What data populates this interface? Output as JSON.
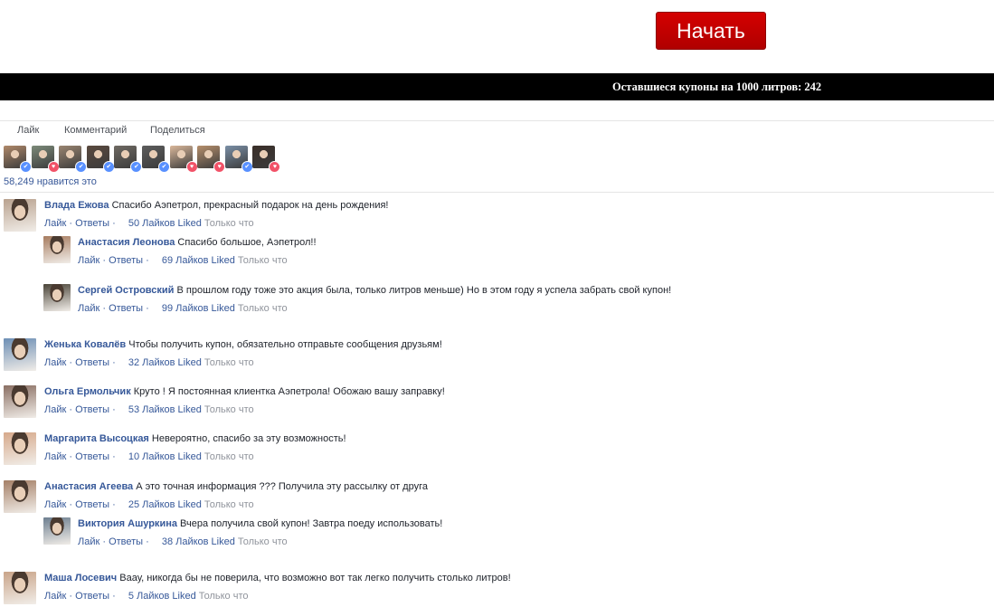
{
  "start_button": {
    "label": "Начать"
  },
  "coupon_bar": {
    "text": "Оставшиеся купоны на 1000 литров: 242"
  },
  "actions": {
    "like": "Лайк",
    "comment": "Комментарий",
    "share": "Поделиться"
  },
  "reactions": {
    "likes_count_text": "58,249 нравится это",
    "reactors": [
      {
        "reaction": "like",
        "color": "#b0896a"
      },
      {
        "reaction": "love",
        "color": "#7d8b7a"
      },
      {
        "reaction": "like",
        "color": "#9a8571"
      },
      {
        "reaction": "like",
        "color": "#5b4a3f"
      },
      {
        "reaction": "like",
        "color": "#6f6a63"
      },
      {
        "reaction": "like",
        "color": "#5d5d5d"
      },
      {
        "reaction": "love",
        "color": "#d9b79a"
      },
      {
        "reaction": "love",
        "color": "#b68f6c"
      },
      {
        "reaction": "like",
        "color": "#7a8fa6"
      },
      {
        "reaction": "love",
        "color": "#3a2e28"
      }
    ]
  },
  "labels": {
    "like": "Лайк",
    "replies": "Ответы",
    "just_now": "Только что",
    "separator": "·"
  },
  "comments": [
    {
      "author": "Влада Ежова",
      "text": "Спасибо Аэпетрол, прекрасный подарок на день рождения!",
      "likes": "50 Лайков Liked",
      "avatar_color": "#b9a28f"
    },
    {
      "author": "Анастасия Леонова",
      "text": "Спасибо большое, Аэпетрол!!",
      "likes": "69 Лайков Liked",
      "avatar_color": "#a77c5f"
    },
    {
      "author": "Сергей Островский",
      "text": "В прошлом году тоже это акция была, только литров меньше) Но в этом году я успела забрать свой купон!",
      "likes": "99 Лайков Liked",
      "avatar_color": "#4a4438"
    },
    {
      "author": "Женька Ковалёв",
      "text": "Чтобы получить купон, обязательно отправьте сообщения друзьям!",
      "likes": "32 Лайков Liked",
      "avatar_color": "#6d8fb5"
    },
    {
      "author": "Ольга Ермольчик",
      "text": "Круто ! Я постоянная клиентка Аэпетрола! Обожаю вашу заправку!",
      "likes": "53 Лайков Liked",
      "avatar_color": "#8a6f63"
    },
    {
      "author": "Маргарита Высоцкая",
      "text": "Невероятно, спасибо за эту возможность!",
      "likes": "10 Лайков Liked",
      "avatar_color": "#d6a98b"
    },
    {
      "author": "Анастасия Агеева",
      "text": "А это точная информация ??? Получила эту рассылку от друга",
      "likes": "25 Лайков Liked",
      "avatar_color": "#a58067"
    },
    {
      "author": "Виктория Ашуркина",
      "text": "Вчера получила свой купон! Завтра поеду использовать!",
      "likes": "38 Лайков Liked",
      "avatar_color": "#6d7f90"
    },
    {
      "author": "Маша Лосевич",
      "text": "Ваау, никогда бы не поверила, что возможно вот так легко получить столько литров!",
      "likes": "5 Лайков Liked",
      "avatar_color": "#c9a489"
    }
  ]
}
